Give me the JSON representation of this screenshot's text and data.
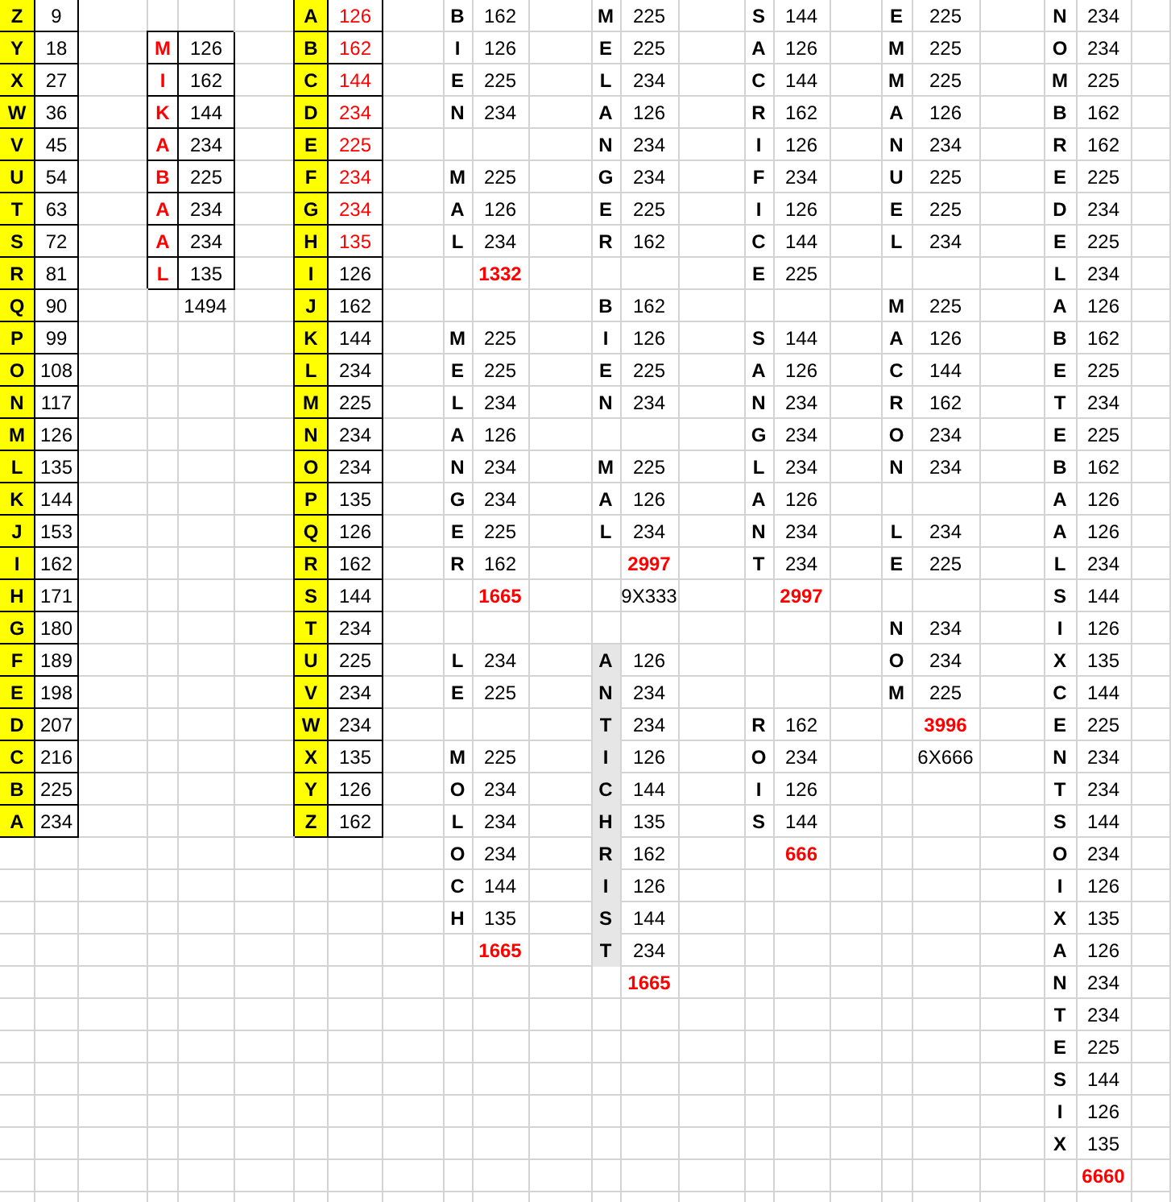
{
  "sheet": {
    "columns": [
      {
        "kind": "letters",
        "cells": [
          {
            "text": "Z",
            "kind": "letter",
            "color": "#ffff00",
            "boxed": true
          },
          {
            "text": "Y",
            "kind": "letter",
            "color": "#ffff00",
            "boxed": true
          },
          {
            "text": "X",
            "kind": "letter",
            "color": "#ffff00",
            "boxed": true
          },
          {
            "text": "W",
            "kind": "letter",
            "color": "#ffff00",
            "boxed": true
          },
          {
            "text": "V",
            "kind": "letter",
            "color": "#ffff00",
            "boxed": true
          },
          {
            "text": "U",
            "kind": "letter",
            "color": "#ffff00",
            "boxed": true
          },
          {
            "text": "T",
            "kind": "letter",
            "color": "#ffff00",
            "boxed": true
          },
          {
            "text": "S",
            "kind": "letter",
            "color": "#ffff00",
            "boxed": true
          },
          {
            "text": "R",
            "kind": "letter",
            "color": "#ffff00",
            "boxed": true
          },
          {
            "text": "Q",
            "kind": "letter",
            "color": "#ffff00",
            "boxed": true
          },
          {
            "text": "P",
            "kind": "letter",
            "color": "#ffff00",
            "boxed": true
          },
          {
            "text": "O",
            "kind": "letter",
            "color": "#ffff00",
            "boxed": true
          },
          {
            "text": "N",
            "kind": "letter",
            "color": "#ffff00",
            "boxed": true
          },
          {
            "text": "M",
            "kind": "letter",
            "color": "#ffff00",
            "boxed": true
          },
          {
            "text": "L",
            "kind": "letter",
            "color": "#ffff00",
            "boxed": true
          },
          {
            "text": "K",
            "kind": "letter",
            "color": "#ffff00",
            "boxed": true
          },
          {
            "text": "J",
            "kind": "letter",
            "color": "#ffff00",
            "boxed": true
          },
          {
            "text": "I",
            "kind": "letter",
            "color": "#ffff00",
            "boxed": true
          },
          {
            "text": "H",
            "kind": "letter",
            "color": "#ffff00",
            "boxed": true
          },
          {
            "text": "G",
            "kind": "letter",
            "color": "#ffff00",
            "boxed": true
          },
          {
            "text": "F",
            "kind": "letter",
            "color": "#ffff00",
            "boxed": true
          },
          {
            "text": "E",
            "kind": "letter",
            "color": "#ffff00",
            "boxed": true
          },
          {
            "text": "D",
            "kind": "letter",
            "color": "#ffff00",
            "boxed": true
          },
          {
            "text": "C",
            "kind": "letter",
            "color": "#ffff00",
            "boxed": true
          },
          {
            "text": "B",
            "kind": "letter",
            "color": "#ffff00",
            "boxed": true
          },
          {
            "text": "A",
            "kind": "letter",
            "color": "#ffff00",
            "boxed": true
          }
        ]
      },
      {
        "kind": "values",
        "cells": [
          {
            "text": "9",
            "kind": "number",
            "boxed": true
          },
          {
            "text": "18",
            "kind": "number",
            "boxed": true
          },
          {
            "text": "27",
            "kind": "number",
            "boxed": true
          },
          {
            "text": "36",
            "kind": "number",
            "boxed": true
          },
          {
            "text": "45",
            "kind": "number",
            "boxed": true
          },
          {
            "text": "54",
            "kind": "number",
            "boxed": true
          },
          {
            "text": "63",
            "kind": "number",
            "boxed": true
          },
          {
            "text": "72",
            "kind": "number",
            "boxed": true
          },
          {
            "text": "81",
            "kind": "number",
            "boxed": true
          },
          {
            "text": "90",
            "kind": "number",
            "boxed": true
          },
          {
            "text": "99",
            "kind": "number",
            "boxed": true
          },
          {
            "text": "108",
            "kind": "number",
            "boxed": true
          },
          {
            "text": "117",
            "kind": "number",
            "boxed": true
          },
          {
            "text": "126",
            "kind": "number",
            "boxed": true
          },
          {
            "text": "135",
            "kind": "number",
            "boxed": true
          },
          {
            "text": "144",
            "kind": "number",
            "boxed": true
          },
          {
            "text": "153",
            "kind": "number",
            "boxed": true
          },
          {
            "text": "162",
            "kind": "number",
            "boxed": true
          },
          {
            "text": "171",
            "kind": "number",
            "boxed": true
          },
          {
            "text": "180",
            "kind": "number",
            "boxed": true
          },
          {
            "text": "189",
            "kind": "number",
            "boxed": true
          },
          {
            "text": "198",
            "kind": "number",
            "boxed": true
          },
          {
            "text": "207",
            "kind": "number",
            "boxed": true
          },
          {
            "text": "216",
            "kind": "number",
            "boxed": true
          },
          {
            "text": "225",
            "kind": "number",
            "boxed": true
          },
          {
            "text": "234",
            "kind": "number",
            "boxed": true
          }
        ]
      },
      {
        "kind": "empty"
      },
      {
        "kind": "letters",
        "cells": [
          null,
          {
            "text": "M",
            "kind": "letter",
            "boxed": true,
            "red": true
          },
          {
            "text": "I",
            "kind": "letter",
            "boxed": true,
            "red": true
          },
          {
            "text": "K",
            "kind": "letter",
            "boxed": true,
            "red": true
          },
          {
            "text": "A",
            "kind": "letter",
            "boxed": true,
            "red": true
          },
          {
            "text": "B",
            "kind": "letter",
            "boxed": true,
            "red": true
          },
          {
            "text": "A",
            "kind": "letter",
            "boxed": true,
            "red": true
          },
          {
            "text": "A",
            "kind": "letter",
            "boxed": true,
            "red": true
          },
          {
            "text": "L",
            "kind": "letter",
            "boxed": true,
            "red": true
          }
        ]
      },
      {
        "kind": "values",
        "cells": [
          null,
          {
            "text": "126",
            "kind": "number",
            "boxed": true
          },
          {
            "text": "162",
            "kind": "number",
            "boxed": true
          },
          {
            "text": "144",
            "kind": "number",
            "boxed": true
          },
          {
            "text": "234",
            "kind": "number",
            "boxed": true
          },
          {
            "text": "225",
            "kind": "number",
            "boxed": true
          },
          {
            "text": "234",
            "kind": "number",
            "boxed": true
          },
          {
            "text": "234",
            "kind": "number",
            "boxed": true
          },
          {
            "text": "135",
            "kind": "number",
            "boxed": true
          },
          {
            "text": "1494",
            "kind": "number"
          }
        ]
      },
      {
        "kind": "empty"
      },
      {
        "kind": "letters",
        "cells": [
          {
            "text": "A",
            "kind": "letter",
            "color": "#ffff00",
            "boxed": true
          },
          {
            "text": "B",
            "kind": "letter",
            "color": "#ffff00",
            "boxed": true
          },
          {
            "text": "C",
            "kind": "letter",
            "color": "#ffff00",
            "boxed": true
          },
          {
            "text": "D",
            "kind": "letter",
            "color": "#ffff00",
            "boxed": true
          },
          {
            "text": "E",
            "kind": "letter",
            "color": "#ffff00",
            "boxed": true
          },
          {
            "text": "F",
            "kind": "letter",
            "color": "#ffff00",
            "boxed": true
          },
          {
            "text": "G",
            "kind": "letter",
            "color": "#ffff00",
            "boxed": true
          },
          {
            "text": "H",
            "kind": "letter",
            "color": "#ffff00",
            "boxed": true
          },
          {
            "text": "I",
            "kind": "letter",
            "color": "#ffff00",
            "boxed": true
          },
          {
            "text": "J",
            "kind": "letter",
            "color": "#ffff00",
            "boxed": true
          },
          {
            "text": "K",
            "kind": "letter",
            "color": "#ffff00",
            "boxed": true
          },
          {
            "text": "L",
            "kind": "letter",
            "color": "#ffff00",
            "boxed": true
          },
          {
            "text": "M",
            "kind": "letter",
            "color": "#ffff00",
            "boxed": true
          },
          {
            "text": "N",
            "kind": "letter",
            "color": "#ffff00",
            "boxed": true
          },
          {
            "text": "O",
            "kind": "letter",
            "color": "#ffff00",
            "boxed": true
          },
          {
            "text": "P",
            "kind": "letter",
            "color": "#ffff00",
            "boxed": true
          },
          {
            "text": "Q",
            "kind": "letter",
            "color": "#ffff00",
            "boxed": true
          },
          {
            "text": "R",
            "kind": "letter",
            "color": "#ffff00",
            "boxed": true
          },
          {
            "text": "S",
            "kind": "letter",
            "color": "#ffff00",
            "boxed": true
          },
          {
            "text": "T",
            "kind": "letter",
            "color": "#ffff00",
            "boxed": true
          },
          {
            "text": "U",
            "kind": "letter",
            "color": "#ffff00",
            "boxed": true
          },
          {
            "text": "V",
            "kind": "letter",
            "color": "#ffff00",
            "boxed": true
          },
          {
            "text": "W",
            "kind": "letter",
            "color": "#ffff00",
            "boxed": true
          },
          {
            "text": "X",
            "kind": "letter",
            "color": "#ffff00",
            "boxed": true
          },
          {
            "text": "Y",
            "kind": "letter",
            "color": "#ffff00",
            "boxed": true
          },
          {
            "text": "Z",
            "kind": "letter",
            "color": "#ffff00",
            "boxed": true
          }
        ]
      },
      {
        "kind": "values",
        "cells": [
          {
            "text": "126",
            "kind": "number",
            "boxed": true,
            "red": true
          },
          {
            "text": "162",
            "kind": "number",
            "boxed": true,
            "red": true
          },
          {
            "text": "144",
            "kind": "number",
            "boxed": true,
            "red": true
          },
          {
            "text": "234",
            "kind": "number",
            "boxed": true,
            "red": true
          },
          {
            "text": "225",
            "kind": "number",
            "boxed": true,
            "red": true
          },
          {
            "text": "234",
            "kind": "number",
            "boxed": true,
            "red": true
          },
          {
            "text": "234",
            "kind": "number",
            "boxed": true,
            "red": true
          },
          {
            "text": "135",
            "kind": "number",
            "boxed": true,
            "red": true
          },
          {
            "text": "126",
            "kind": "number",
            "boxed": true
          },
          {
            "text": "162",
            "kind": "number",
            "boxed": true
          },
          {
            "text": "144",
            "kind": "number",
            "boxed": true
          },
          {
            "text": "234",
            "kind": "number",
            "boxed": true
          },
          {
            "text": "225",
            "kind": "number",
            "boxed": true
          },
          {
            "text": "234",
            "kind": "number",
            "boxed": true
          },
          {
            "text": "234",
            "kind": "number",
            "boxed": true
          },
          {
            "text": "135",
            "kind": "number",
            "boxed": true
          },
          {
            "text": "126",
            "kind": "number",
            "boxed": true
          },
          {
            "text": "162",
            "kind": "number",
            "boxed": true
          },
          {
            "text": "144",
            "kind": "number",
            "boxed": true
          },
          {
            "text": "234",
            "kind": "number",
            "boxed": true
          },
          {
            "text": "225",
            "kind": "number",
            "boxed": true
          },
          {
            "text": "234",
            "kind": "number",
            "boxed": true
          },
          {
            "text": "234",
            "kind": "number",
            "boxed": true
          },
          {
            "text": "135",
            "kind": "number",
            "boxed": true
          },
          {
            "text": "126",
            "kind": "number",
            "boxed": true
          },
          {
            "text": "162",
            "kind": "number",
            "boxed": true
          }
        ]
      },
      {
        "kind": "empty"
      },
      {
        "kind": "letters",
        "cells": [
          {
            "text": "B",
            "kind": "letter"
          },
          {
            "text": "I",
            "kind": "letter"
          },
          {
            "text": "E",
            "kind": "letter"
          },
          {
            "text": "N",
            "kind": "letter"
          },
          null,
          {
            "text": "M",
            "kind": "letter"
          },
          {
            "text": "A",
            "kind": "letter"
          },
          {
            "text": "L",
            "kind": "letter"
          },
          null,
          null,
          {
            "text": "M",
            "kind": "letter"
          },
          {
            "text": "E",
            "kind": "letter"
          },
          {
            "text": "L",
            "kind": "letter"
          },
          {
            "text": "A",
            "kind": "letter"
          },
          {
            "text": "N",
            "kind": "letter"
          },
          {
            "text": "G",
            "kind": "letter"
          },
          {
            "text": "E",
            "kind": "letter"
          },
          {
            "text": "R",
            "kind": "letter"
          },
          null,
          null,
          {
            "text": "L",
            "kind": "letter"
          },
          {
            "text": "E",
            "kind": "letter"
          },
          null,
          {
            "text": "M",
            "kind": "letter"
          },
          {
            "text": "O",
            "kind": "letter"
          },
          {
            "text": "L",
            "kind": "letter"
          },
          {
            "text": "O",
            "kind": "letter"
          },
          {
            "text": "C",
            "kind": "letter"
          },
          {
            "text": "H",
            "kind": "letter"
          }
        ]
      },
      {
        "kind": "values",
        "cells": [
          {
            "text": "162",
            "kind": "number"
          },
          {
            "text": "126",
            "kind": "number"
          },
          {
            "text": "225",
            "kind": "number"
          },
          {
            "text": "234",
            "kind": "number"
          },
          null,
          {
            "text": "225",
            "kind": "number"
          },
          {
            "text": "126",
            "kind": "number"
          },
          {
            "text": "234",
            "kind": "number"
          },
          {
            "text": "1332",
            "kind": "total"
          },
          null,
          {
            "text": "225",
            "kind": "number"
          },
          {
            "text": "225",
            "kind": "number"
          },
          {
            "text": "234",
            "kind": "number"
          },
          {
            "text": "126",
            "kind": "number"
          },
          {
            "text": "234",
            "kind": "number"
          },
          {
            "text": "234",
            "kind": "number"
          },
          {
            "text": "225",
            "kind": "number"
          },
          {
            "text": "162",
            "kind": "number"
          },
          {
            "text": "1665",
            "kind": "total"
          },
          null,
          {
            "text": "234",
            "kind": "number"
          },
          {
            "text": "225",
            "kind": "number"
          },
          null,
          {
            "text": "225",
            "kind": "number"
          },
          {
            "text": "234",
            "kind": "number"
          },
          {
            "text": "234",
            "kind": "number"
          },
          {
            "text": "234",
            "kind": "number"
          },
          {
            "text": "144",
            "kind": "number"
          },
          {
            "text": "135",
            "kind": "number"
          },
          {
            "text": "1665",
            "kind": "total"
          }
        ]
      },
      {
        "kind": "empty"
      },
      {
        "kind": "letters",
        "cells": [
          {
            "text": "M",
            "kind": "letter"
          },
          {
            "text": "E",
            "kind": "letter"
          },
          {
            "text": "L",
            "kind": "letter"
          },
          {
            "text": "A",
            "kind": "letter"
          },
          {
            "text": "N",
            "kind": "letter"
          },
          {
            "text": "G",
            "kind": "letter"
          },
          {
            "text": "E",
            "kind": "letter"
          },
          {
            "text": "R",
            "kind": "letter"
          },
          null,
          {
            "text": "B",
            "kind": "letter"
          },
          {
            "text": "I",
            "kind": "letter"
          },
          {
            "text": "E",
            "kind": "letter"
          },
          {
            "text": "N",
            "kind": "letter"
          },
          null,
          {
            "text": "M",
            "kind": "letter"
          },
          {
            "text": "A",
            "kind": "letter"
          },
          {
            "text": "L",
            "kind": "letter"
          },
          null,
          null,
          null,
          {
            "text": "A",
            "kind": "letter",
            "color": "#e7e6e6"
          },
          {
            "text": "N",
            "kind": "letter",
            "color": "#e7e6e6"
          },
          {
            "text": "T",
            "kind": "letter",
            "color": "#e7e6e6"
          },
          {
            "text": "I",
            "kind": "letter",
            "color": "#e7e6e6"
          },
          {
            "text": "C",
            "kind": "letter",
            "color": "#e7e6e6"
          },
          {
            "text": "H",
            "kind": "letter",
            "color": "#e7e6e6"
          },
          {
            "text": "R",
            "kind": "letter",
            "color": "#e7e6e6"
          },
          {
            "text": "I",
            "kind": "letter",
            "color": "#e7e6e6"
          },
          {
            "text": "S",
            "kind": "letter",
            "color": "#e7e6e6"
          },
          {
            "text": "T",
            "kind": "letter",
            "color": "#e7e6e6"
          }
        ]
      },
      {
        "kind": "values",
        "cells": [
          {
            "text": "225",
            "kind": "number"
          },
          {
            "text": "225",
            "kind": "number"
          },
          {
            "text": "234",
            "kind": "number"
          },
          {
            "text": "126",
            "kind": "number"
          },
          {
            "text": "234",
            "kind": "number"
          },
          {
            "text": "234",
            "kind": "number"
          },
          {
            "text": "225",
            "kind": "number"
          },
          {
            "text": "162",
            "kind": "number"
          },
          null,
          {
            "text": "162",
            "kind": "number"
          },
          {
            "text": "126",
            "kind": "number"
          },
          {
            "text": "225",
            "kind": "number"
          },
          {
            "text": "234",
            "kind": "number"
          },
          null,
          {
            "text": "225",
            "kind": "number"
          },
          {
            "text": "126",
            "kind": "number"
          },
          {
            "text": "234",
            "kind": "number"
          },
          {
            "text": "2997",
            "kind": "total"
          },
          {
            "text": "9X333",
            "kind": "number"
          },
          null,
          {
            "text": "126",
            "kind": "number"
          },
          {
            "text": "234",
            "kind": "number"
          },
          {
            "text": "234",
            "kind": "number"
          },
          {
            "text": "126",
            "kind": "number"
          },
          {
            "text": "144",
            "kind": "number"
          },
          {
            "text": "135",
            "kind": "number"
          },
          {
            "text": "162",
            "kind": "number"
          },
          {
            "text": "126",
            "kind": "number"
          },
          {
            "text": "144",
            "kind": "number"
          },
          {
            "text": "234",
            "kind": "number"
          },
          {
            "text": "1665",
            "kind": "total"
          }
        ]
      },
      {
        "kind": "empty"
      },
      {
        "kind": "letters",
        "cells": [
          {
            "text": "S",
            "kind": "letter"
          },
          {
            "text": "A",
            "kind": "letter"
          },
          {
            "text": "C",
            "kind": "letter"
          },
          {
            "text": "R",
            "kind": "letter"
          },
          {
            "text": "I",
            "kind": "letter"
          },
          {
            "text": "F",
            "kind": "letter"
          },
          {
            "text": "I",
            "kind": "letter"
          },
          {
            "text": "C",
            "kind": "letter"
          },
          {
            "text": "E",
            "kind": "letter"
          },
          null,
          {
            "text": "S",
            "kind": "letter"
          },
          {
            "text": "A",
            "kind": "letter"
          },
          {
            "text": "N",
            "kind": "letter"
          },
          {
            "text": "G",
            "kind": "letter"
          },
          {
            "text": "L",
            "kind": "letter"
          },
          {
            "text": "A",
            "kind": "letter"
          },
          {
            "text": "N",
            "kind": "letter"
          },
          {
            "text": "T",
            "kind": "letter"
          },
          null,
          null,
          null,
          null,
          {
            "text": "R",
            "kind": "letter"
          },
          {
            "text": "O",
            "kind": "letter"
          },
          {
            "text": "I",
            "kind": "letter"
          },
          {
            "text": "S",
            "kind": "letter"
          }
        ]
      },
      {
        "kind": "values",
        "cells": [
          {
            "text": "144",
            "kind": "number"
          },
          {
            "text": "126",
            "kind": "number"
          },
          {
            "text": "144",
            "kind": "number"
          },
          {
            "text": "162",
            "kind": "number"
          },
          {
            "text": "126",
            "kind": "number"
          },
          {
            "text": "234",
            "kind": "number"
          },
          {
            "text": "126",
            "kind": "number"
          },
          {
            "text": "144",
            "kind": "number"
          },
          {
            "text": "225",
            "kind": "number"
          },
          null,
          {
            "text": "144",
            "kind": "number"
          },
          {
            "text": "126",
            "kind": "number"
          },
          {
            "text": "234",
            "kind": "number"
          },
          {
            "text": "234",
            "kind": "number"
          },
          {
            "text": "234",
            "kind": "number"
          },
          {
            "text": "126",
            "kind": "number"
          },
          {
            "text": "234",
            "kind": "number"
          },
          {
            "text": "234",
            "kind": "number"
          },
          {
            "text": "2997",
            "kind": "total"
          },
          null,
          null,
          null,
          {
            "text": "162",
            "kind": "number"
          },
          {
            "text": "234",
            "kind": "number"
          },
          {
            "text": "126",
            "kind": "number"
          },
          {
            "text": "144",
            "kind": "number"
          },
          {
            "text": "666",
            "kind": "total"
          }
        ]
      },
      {
        "kind": "empty"
      },
      {
        "kind": "letters",
        "cells": [
          {
            "text": "E",
            "kind": "letter"
          },
          {
            "text": "M",
            "kind": "letter"
          },
          {
            "text": "M",
            "kind": "letter"
          },
          {
            "text": "A",
            "kind": "letter"
          },
          {
            "text": "N",
            "kind": "letter"
          },
          {
            "text": "U",
            "kind": "letter"
          },
          {
            "text": "E",
            "kind": "letter"
          },
          {
            "text": "L",
            "kind": "letter"
          },
          null,
          {
            "text": "M",
            "kind": "letter"
          },
          {
            "text": "A",
            "kind": "letter"
          },
          {
            "text": "C",
            "kind": "letter"
          },
          {
            "text": "R",
            "kind": "letter"
          },
          {
            "text": "O",
            "kind": "letter"
          },
          {
            "text": "N",
            "kind": "letter"
          },
          null,
          {
            "text": "L",
            "kind": "letter"
          },
          {
            "text": "E",
            "kind": "letter"
          },
          null,
          {
            "text": "N",
            "kind": "letter"
          },
          {
            "text": "O",
            "kind": "letter"
          },
          {
            "text": "M",
            "kind": "letter"
          }
        ]
      },
      {
        "kind": "values",
        "cells": [
          {
            "text": "225",
            "kind": "number"
          },
          {
            "text": "225",
            "kind": "number"
          },
          {
            "text": "225",
            "kind": "number"
          },
          {
            "text": "126",
            "kind": "number"
          },
          {
            "text": "234",
            "kind": "number"
          },
          {
            "text": "225",
            "kind": "number"
          },
          {
            "text": "225",
            "kind": "number"
          },
          {
            "text": "234",
            "kind": "number"
          },
          null,
          {
            "text": "225",
            "kind": "number"
          },
          {
            "text": "126",
            "kind": "number"
          },
          {
            "text": "144",
            "kind": "number"
          },
          {
            "text": "162",
            "kind": "number"
          },
          {
            "text": "234",
            "kind": "number"
          },
          {
            "text": "234",
            "kind": "number"
          },
          null,
          {
            "text": "234",
            "kind": "number"
          },
          {
            "text": "225",
            "kind": "number"
          },
          null,
          {
            "text": "234",
            "kind": "number"
          },
          {
            "text": "234",
            "kind": "number"
          },
          {
            "text": "225",
            "kind": "number"
          },
          {
            "text": "3996",
            "kind": "total"
          },
          {
            "text": "6X666",
            "kind": "number"
          }
        ]
      },
      {
        "kind": "empty"
      },
      {
        "kind": "letters",
        "cells": [
          {
            "text": "N",
            "kind": "letter"
          },
          {
            "text": "O",
            "kind": "letter"
          },
          {
            "text": "M",
            "kind": "letter"
          },
          {
            "text": "B",
            "kind": "letter"
          },
          {
            "text": "R",
            "kind": "letter"
          },
          {
            "text": "E",
            "kind": "letter"
          },
          {
            "text": "D",
            "kind": "letter"
          },
          {
            "text": "E",
            "kind": "letter"
          },
          {
            "text": "L",
            "kind": "letter"
          },
          {
            "text": "A",
            "kind": "letter"
          },
          {
            "text": "B",
            "kind": "letter"
          },
          {
            "text": "E",
            "kind": "letter"
          },
          {
            "text": "T",
            "kind": "letter"
          },
          {
            "text": "E",
            "kind": "letter"
          },
          {
            "text": "B",
            "kind": "letter"
          },
          {
            "text": "A",
            "kind": "letter"
          },
          {
            "text": "A",
            "kind": "letter"
          },
          {
            "text": "L",
            "kind": "letter"
          },
          {
            "text": "S",
            "kind": "letter"
          },
          {
            "text": "I",
            "kind": "letter"
          },
          {
            "text": "X",
            "kind": "letter"
          },
          {
            "text": "C",
            "kind": "letter"
          },
          {
            "text": "E",
            "kind": "letter"
          },
          {
            "text": "N",
            "kind": "letter"
          },
          {
            "text": "T",
            "kind": "letter"
          },
          {
            "text": "S",
            "kind": "letter"
          },
          {
            "text": "O",
            "kind": "letter"
          },
          {
            "text": "I",
            "kind": "letter"
          },
          {
            "text": "X",
            "kind": "letter"
          },
          {
            "text": "A",
            "kind": "letter"
          },
          {
            "text": "N",
            "kind": "letter"
          },
          {
            "text": "T",
            "kind": "letter"
          },
          {
            "text": "E",
            "kind": "letter"
          },
          {
            "text": "S",
            "kind": "letter"
          },
          {
            "text": "I",
            "kind": "letter"
          },
          {
            "text": "X",
            "kind": "letter"
          }
        ]
      },
      {
        "kind": "values",
        "cells": [
          {
            "text": "234",
            "kind": "number"
          },
          {
            "text": "234",
            "kind": "number"
          },
          {
            "text": "225",
            "kind": "number"
          },
          {
            "text": "162",
            "kind": "number"
          },
          {
            "text": "162",
            "kind": "number"
          },
          {
            "text": "225",
            "kind": "number"
          },
          {
            "text": "234",
            "kind": "number"
          },
          {
            "text": "225",
            "kind": "number"
          },
          {
            "text": "234",
            "kind": "number"
          },
          {
            "text": "126",
            "kind": "number"
          },
          {
            "text": "162",
            "kind": "number"
          },
          {
            "text": "225",
            "kind": "number"
          },
          {
            "text": "234",
            "kind": "number"
          },
          {
            "text": "225",
            "kind": "number"
          },
          {
            "text": "162",
            "kind": "number"
          },
          {
            "text": "126",
            "kind": "number"
          },
          {
            "text": "126",
            "kind": "number"
          },
          {
            "text": "234",
            "kind": "number"
          },
          {
            "text": "144",
            "kind": "number"
          },
          {
            "text": "126",
            "kind": "number"
          },
          {
            "text": "135",
            "kind": "number"
          },
          {
            "text": "144",
            "kind": "number"
          },
          {
            "text": "225",
            "kind": "number"
          },
          {
            "text": "234",
            "kind": "number"
          },
          {
            "text": "234",
            "kind": "number"
          },
          {
            "text": "144",
            "kind": "number"
          },
          {
            "text": "234",
            "kind": "number"
          },
          {
            "text": "126",
            "kind": "number"
          },
          {
            "text": "135",
            "kind": "number"
          },
          {
            "text": "126",
            "kind": "number"
          },
          {
            "text": "234",
            "kind": "number"
          },
          {
            "text": "234",
            "kind": "number"
          },
          {
            "text": "225",
            "kind": "number"
          },
          {
            "text": "144",
            "kind": "number"
          },
          {
            "text": "126",
            "kind": "number"
          },
          {
            "text": "135",
            "kind": "number"
          },
          {
            "text": "6660",
            "kind": "total"
          }
        ]
      },
      {
        "kind": "empty"
      }
    ]
  }
}
